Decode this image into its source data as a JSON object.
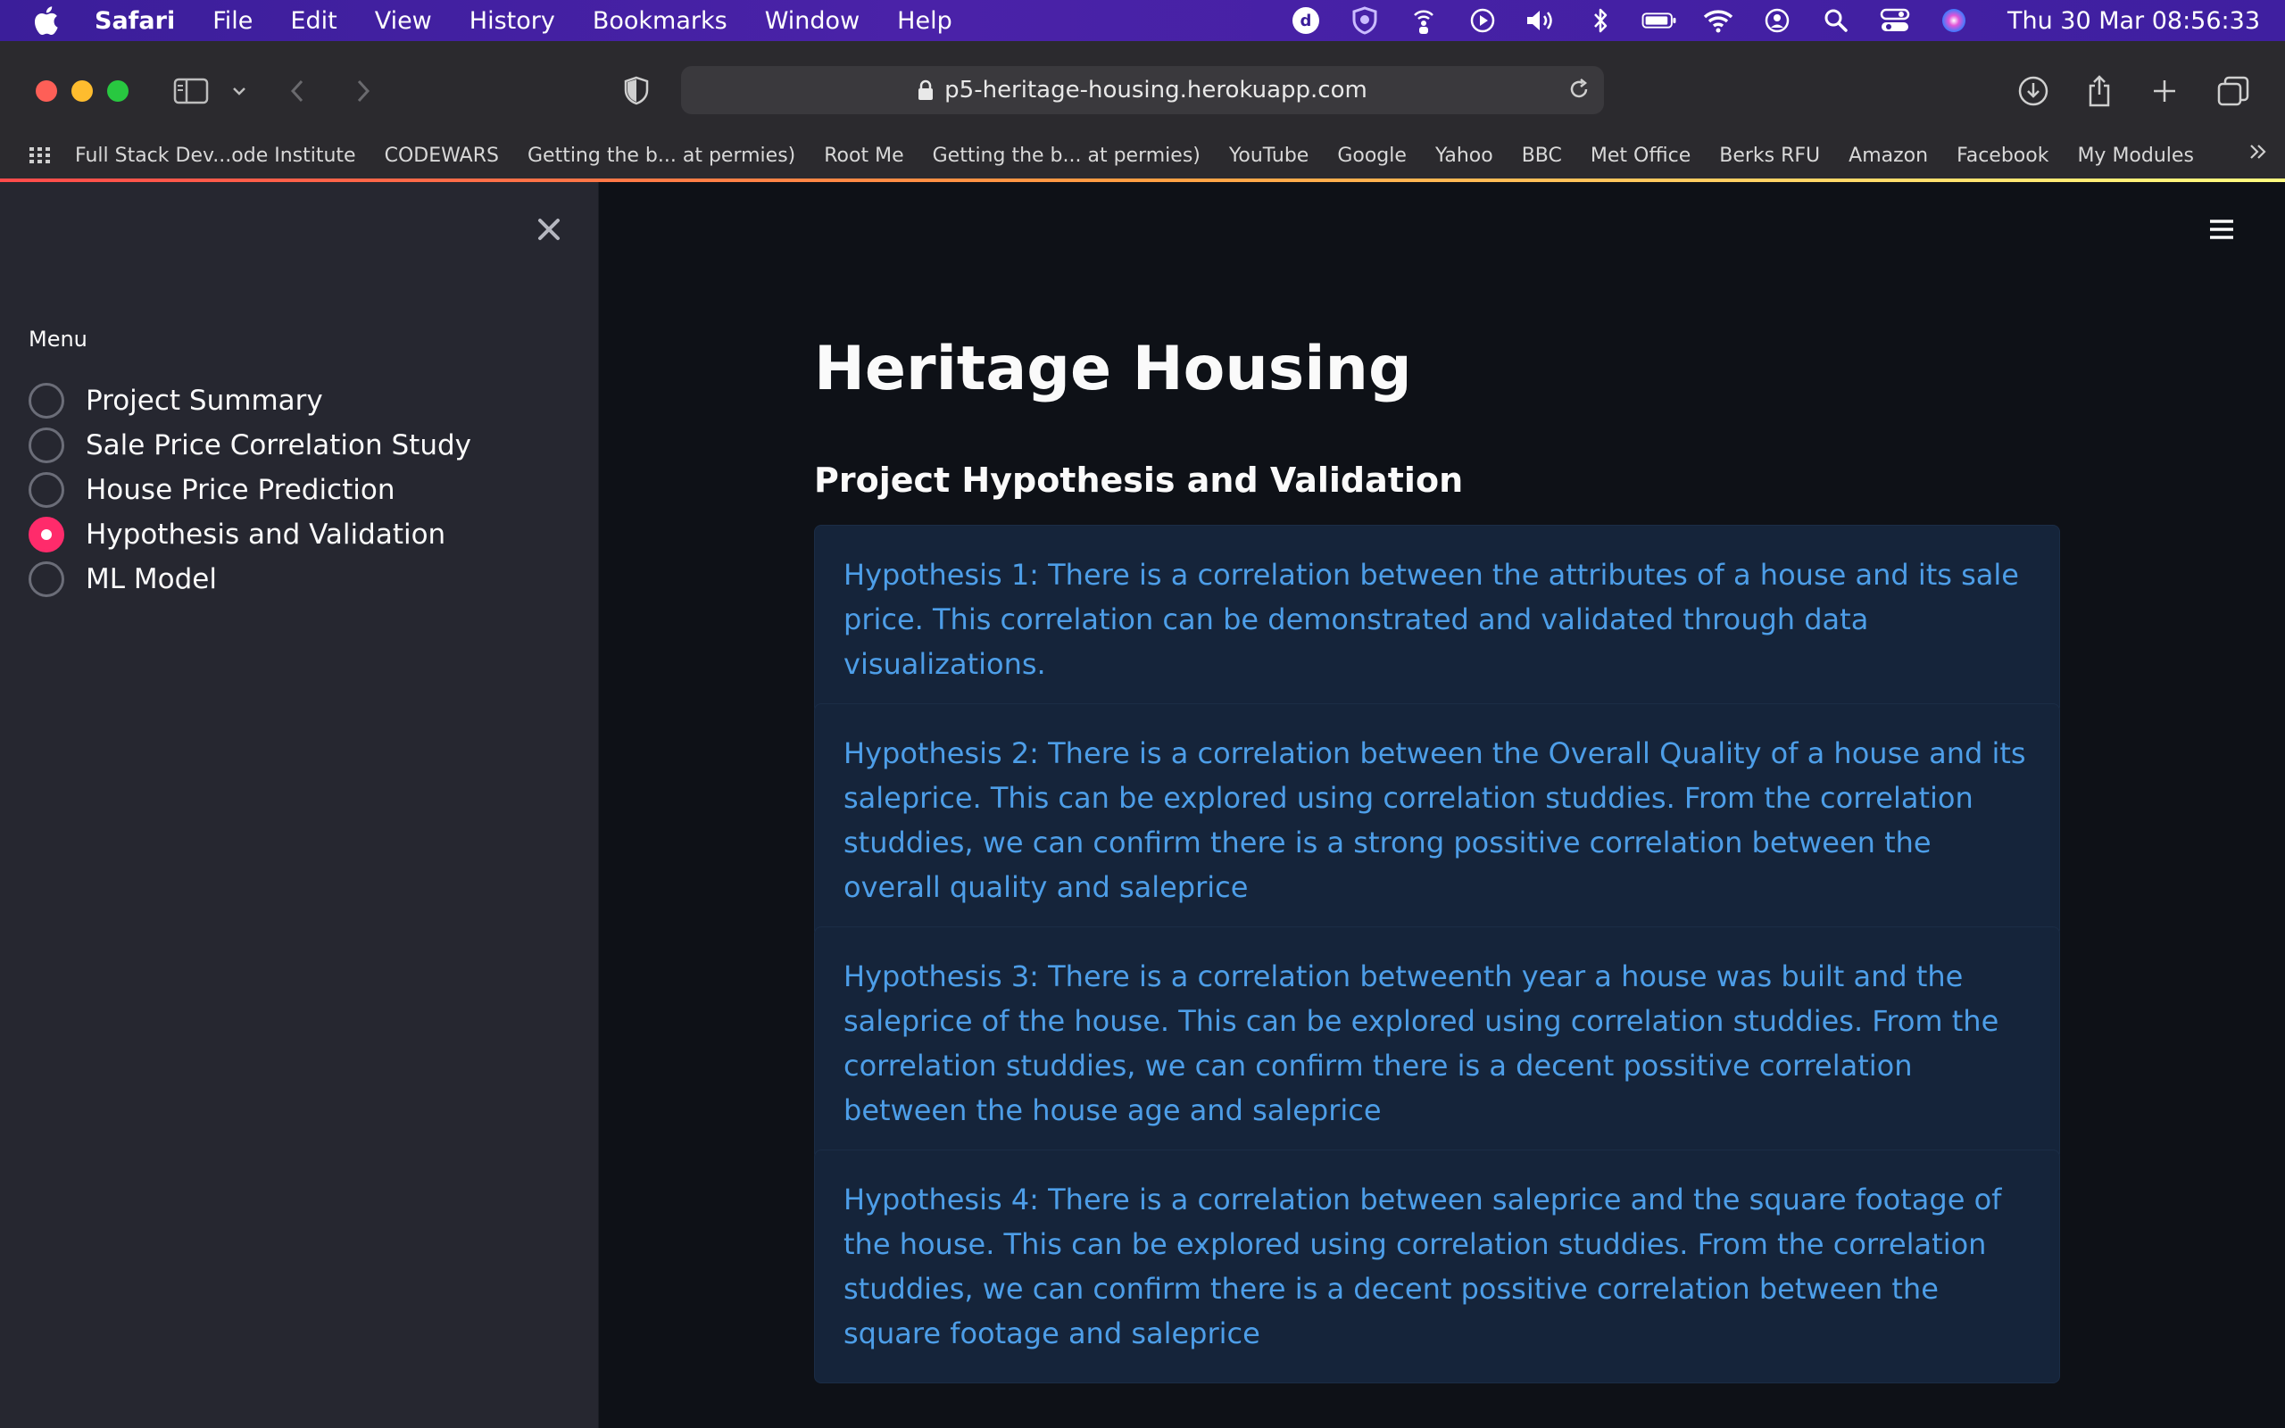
{
  "menubar": {
    "app_name": "Safari",
    "items": [
      "File",
      "Edit",
      "View",
      "History",
      "Bookmarks",
      "Window",
      "Help"
    ],
    "clock": "Thu 30 Mar  08:56:33",
    "status_icons": [
      "d-icon",
      "shield-icon",
      "person-wifi-icon",
      "play-circle-icon",
      "volume-icon",
      "bluetooth-icon",
      "battery-icon",
      "wifi-icon",
      "user-circle-icon",
      "search-icon",
      "control-center-icon",
      "siri-icon"
    ]
  },
  "browser": {
    "url": "p5-heritage-housing.herokuapp.com",
    "bookmarks": [
      "Full Stack Dev...ode Institute",
      "CODEWARS",
      "Getting the b... at permies)",
      "Root Me",
      "Getting the b... at permies)",
      "YouTube",
      "Google",
      "Yahoo",
      "BBC",
      "Met Office",
      "Berks RFU",
      "Amazon",
      "Facebook",
      "My Modules"
    ]
  },
  "sidebar": {
    "menu_label": "Menu",
    "options": [
      {
        "label": "Project Summary",
        "selected": false
      },
      {
        "label": "Sale Price Correlation Study",
        "selected": false
      },
      {
        "label": "House Price Prediction",
        "selected": false
      },
      {
        "label": "Hypothesis and Validation",
        "selected": true
      },
      {
        "label": "ML Model",
        "selected": false
      }
    ]
  },
  "main": {
    "title": "Heritage Housing",
    "subtitle": "Project Hypothesis and Validation",
    "hypotheses": [
      "Hypothesis 1: There is a correlation between the attributes of a house and its sale price. This correlation can be demonstrated and validated through data visualizations.",
      "Hypothesis 2: There is a correlation between the Overall Quality of a house and its saleprice. This can be explored using correlation studdies. From the correlation studdies, we can confirm there is a strong possitive correlation between the overall quality and saleprice",
      "Hypothesis 3: There is a correlation betweenth year a house was built and the saleprice of the house. This can be explored using correlation studdies. From the correlation studdies, we can confirm there is a decent possitive correlation between the house age and saleprice",
      "Hypothesis 4: There is a correlation between saleprice and the square footage of the house. This can be explored using correlation studdies. From the correlation studdies, we can confirm there is a decent possitive correlation between the square footage and saleprice"
    ]
  },
  "colors": {
    "sidebar_bg": "#262730",
    "main_bg": "#0e1117",
    "radio_accent": "#ff2b6b",
    "info_text": "#4d9ee8",
    "info_bg": "#15243a"
  }
}
